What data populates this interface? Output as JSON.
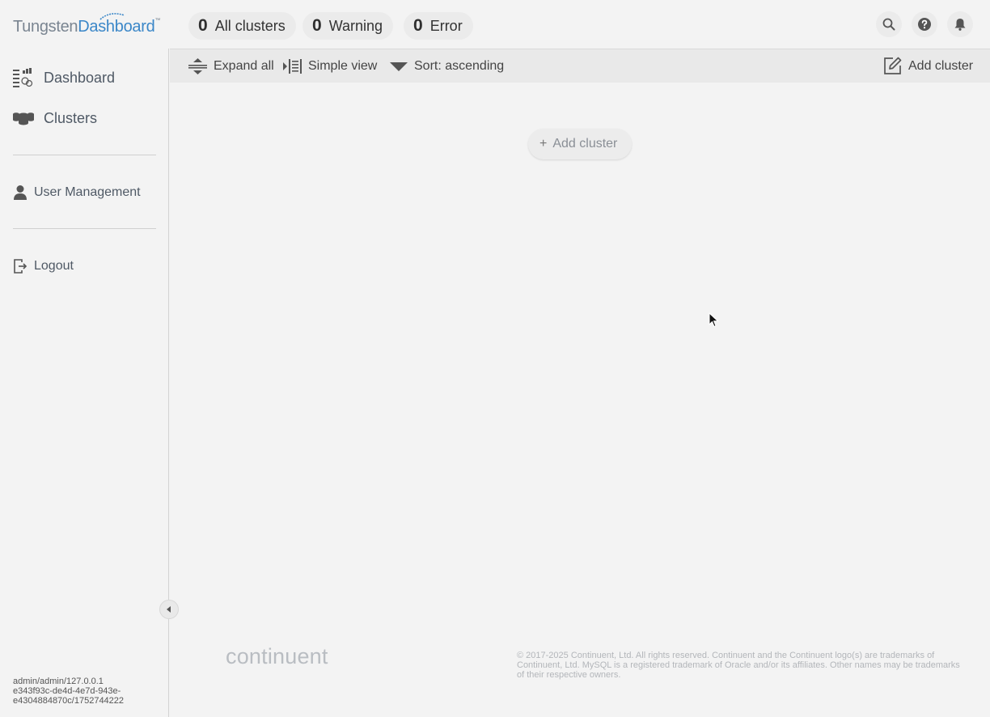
{
  "app": {
    "logo_light": "Tungsten",
    "logo_bold": "Dashboard",
    "logo_tm": "™"
  },
  "stats": [
    {
      "count": "0",
      "label": "All clusters"
    },
    {
      "count": "0",
      "label": "Warning"
    },
    {
      "count": "0",
      "label": "Error"
    }
  ],
  "header_icons": [
    "search-icon",
    "help-icon",
    "bell-icon"
  ],
  "sidebar": {
    "items": [
      {
        "label": "Dashboard",
        "icon": "dashboard-icon"
      },
      {
        "label": "Clusters",
        "icon": "clusters-icon"
      },
      {
        "label": "User Management",
        "icon": "user-icon"
      },
      {
        "label": "Logout",
        "icon": "logout-icon"
      }
    ],
    "session_line1": "admin/admin/127.0.0.1",
    "session_line2": "e343f93c-de4d-4e7d-943e-",
    "session_line3": "e4304884870c/1752744222"
  },
  "toolbar": {
    "expand_all": "Expand all",
    "simple_view": "Simple view",
    "sort": "Sort: ascending",
    "add_cluster": "Add cluster"
  },
  "main": {
    "add_cluster_plus": "+",
    "add_cluster_label": "Add cluster"
  },
  "footer": {
    "brand": "continuent",
    "legal": "© 2017-2025 Continuent, Ltd. All rights reserved. Continuent and the Continuent logo(s) are trademarks of Continuent, Ltd. MySQL is a registered trademark of Oracle and/or its affiliates. Other names may be trademarks of their respective owners."
  },
  "colors": {
    "background": "#f3f3f3",
    "toolbar": "#e9e9e9",
    "brand_blue": "#3b87c8"
  }
}
